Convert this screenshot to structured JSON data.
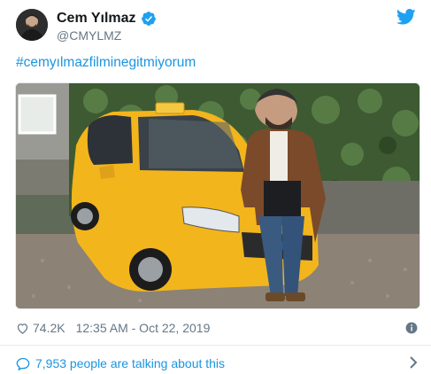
{
  "author": {
    "display_name": "Cem Yılmaz",
    "handle": "@CMYLMZ",
    "verified": true
  },
  "tweet": {
    "hashtag": "#cemyılmazfilminegitmiyorum"
  },
  "stats": {
    "likes": "74.2K",
    "timestamp": "12:35 AM - Oct 22, 2019"
  },
  "footer": {
    "talking_text": "7,953 people are talking about this"
  },
  "icons": {
    "twitter": "twitter-bird-icon",
    "verified": "verified-badge-icon",
    "heart": "heart-icon",
    "info": "info-icon",
    "comment": "comment-bubble-icon",
    "chevron": "chevron-right-icon"
  },
  "colors": {
    "link_blue": "#1b95e0",
    "text_dark": "#14171a",
    "text_muted": "#657786",
    "taxi_yellow": "#f2b51c"
  }
}
